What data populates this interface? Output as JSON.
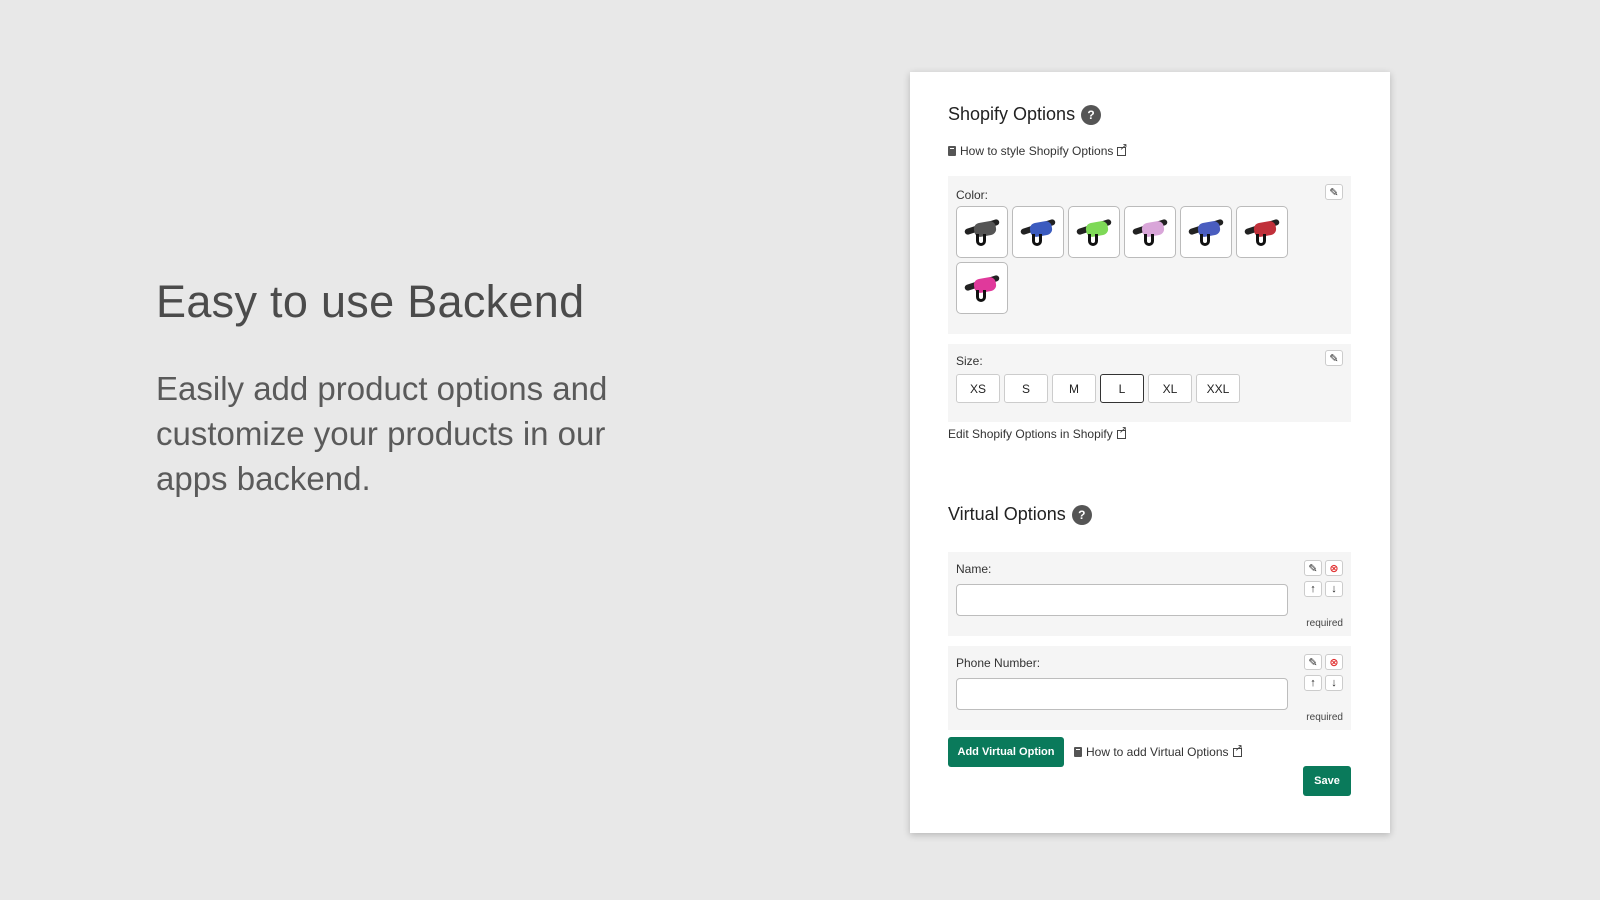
{
  "hero": {
    "title": "Easy to use Backend",
    "subtitle": "Easily add product options and customize your products in our apps backend."
  },
  "shopify": {
    "title": "Shopify Options",
    "help": "?",
    "style_link": "How to style Shopify Options",
    "color_label": "Color:",
    "swatch_colors": [
      "#555555",
      "#3b5bbf",
      "#7ed957",
      "#d9a6d9",
      "#4a5dbf",
      "#c0303a",
      "#e0399b"
    ],
    "size_label": "Size:",
    "sizes": [
      "XS",
      "S",
      "M",
      "L",
      "XL",
      "XXL"
    ],
    "selected_size": "L",
    "edit_link": "Edit Shopify Options in Shopify"
  },
  "virtual": {
    "title": "Virtual Options",
    "help": "?",
    "fields": [
      {
        "label": "Name:",
        "value": "",
        "required_text": "required"
      },
      {
        "label": "Phone Number:",
        "value": "",
        "required_text": "required"
      }
    ],
    "add_button": "Add Virtual Option",
    "add_link": "How to add Virtual Options",
    "save_button": "Save"
  },
  "icons": {
    "edit": "✎",
    "remove": "⊗",
    "up": "↑",
    "down": "↓"
  },
  "colors": {
    "accent": "#0a7a5b",
    "background": "#e8e8e8",
    "panel": "#ffffff",
    "option_box": "#f5f5f5"
  }
}
